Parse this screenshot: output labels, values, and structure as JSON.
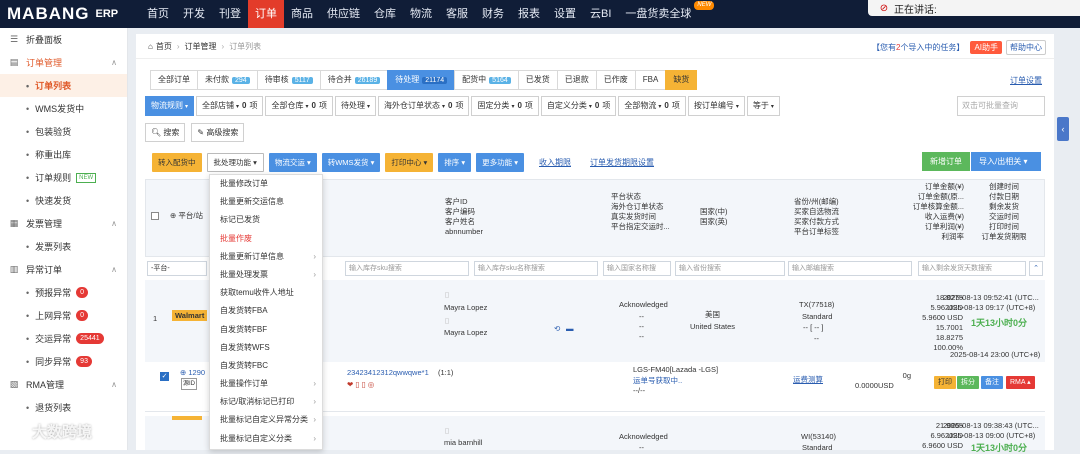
{
  "app": {
    "logo_text": "MABANG",
    "logo_o": "O",
    "logo_suffix": "ERP",
    "nav": [
      {
        "label": "首页"
      },
      {
        "label": "开发"
      },
      {
        "label": "刊登"
      },
      {
        "label": "订单",
        "active": true
      },
      {
        "label": "商品"
      },
      {
        "label": "供应链"
      },
      {
        "label": "仓库"
      },
      {
        "label": "物流"
      },
      {
        "label": "客服"
      },
      {
        "label": "财务"
      },
      {
        "label": "报表"
      },
      {
        "label": "设置"
      },
      {
        "label": "云BI"
      },
      {
        "label": "一盘货卖全球",
        "badge": "NEW"
      }
    ],
    "speaking": "正在讲话:"
  },
  "sidebar": {
    "collapse_label": "折叠面板",
    "groups": [
      {
        "label": "订单管理",
        "open": true,
        "items": [
          {
            "label": "订单列表",
            "selected": true
          },
          {
            "label": "WMS发货中"
          },
          {
            "label": "包装验货"
          },
          {
            "label": "称重出库"
          },
          {
            "label": "订单规则",
            "tag": "NEW"
          },
          {
            "label": "快速发货"
          }
        ]
      },
      {
        "label": "发票管理",
        "open": false,
        "items": [
          {
            "label": "发票列表"
          }
        ]
      },
      {
        "label": "异常订单",
        "open": false,
        "items": [
          {
            "label": "预报异常",
            "badge": "0"
          },
          {
            "label": "上网异常",
            "badge": "0"
          },
          {
            "label": "交运异常",
            "badge": "25441"
          },
          {
            "label": "同步异常",
            "badge": "93"
          }
        ]
      },
      {
        "label": "RMA管理",
        "open": false,
        "items": [
          {
            "label": "退货列表"
          }
        ]
      }
    ]
  },
  "breadcrumb": {
    "home": "首页",
    "level1": "订单管理",
    "current": "订单列表"
  },
  "tasks": {
    "prefix": "【您有",
    "count": "2",
    "suffix": "个导入中的任务】",
    "ai": "AI助手",
    "help": "帮助中心"
  },
  "tabs": [
    {
      "label": "全部订单"
    },
    {
      "label": "未付款",
      "count": "294"
    },
    {
      "label": "待审核",
      "count": "5117"
    },
    {
      "label": "待合并",
      "count": "26189"
    },
    {
      "label": "待处理",
      "count": "21174",
      "active": true
    },
    {
      "label": "配货中",
      "count": "5164"
    },
    {
      "label": "已发货"
    },
    {
      "label": "已退款"
    },
    {
      "label": "已作废"
    },
    {
      "label": "FBA"
    },
    {
      "label": "缺货",
      "orange": true
    }
  ],
  "order_settings": "订单设置",
  "filters_row1": [
    {
      "label": "物流规则",
      "style": "blue"
    },
    {
      "label": "全部店铺",
      "count": "0",
      "unit": "项"
    },
    {
      "label": "全部仓库",
      "count": "0",
      "unit": "项"
    },
    {
      "label": "待处理"
    },
    {
      "label": "海外仓订单状态",
      "count": "0",
      "unit": "项"
    },
    {
      "label": "固定分类",
      "count": "0",
      "unit": "项"
    },
    {
      "label": "自定义分类",
      "count": "0",
      "unit": "项"
    },
    {
      "label": "全部物流",
      "count": "0",
      "unit": "项"
    },
    {
      "label": "按订单编号"
    },
    {
      "label": "等于"
    }
  ],
  "search_placeholder": "双击可批量查询",
  "row2": {
    "search": "搜索",
    "advanced": "高级搜索"
  },
  "actions": {
    "to_allocation": "转入配货中",
    "batch": "批处理功能",
    "logistics": "物流交运",
    "to_wms": "转WMS发货",
    "print": "打印中心",
    "sort": "排序",
    "more": "更多功能",
    "deadline": "收入期限",
    "ship_deadline_settings": "订单发货期限设置",
    "new_order": "新增订单",
    "import_export": "导入/出相关"
  },
  "table_headers": {
    "platform": "平台/站",
    "customer": [
      "客户ID",
      "客户编码",
      "客户姓名",
      "abnnumber"
    ],
    "status": [
      "平台状态",
      "海外仓订单状态",
      "真实发货时间",
      "平台指定交运时..."
    ],
    "country": [
      "国家(中)",
      "国家(英)"
    ],
    "region": [
      "省份/州(邮编)",
      "买家自选物流",
      "买家付款方式",
      "平台订单标签"
    ],
    "amount": [
      "订单金额(¥)",
      "订单金额(原...",
      "订单核算金额...",
      "收入运费(¥)",
      "订单利润(¥)",
      "利润率"
    ],
    "time": [
      "创建时间",
      "付款日期",
      "剩余发货",
      "交运时间",
      "打印时间",
      "订单发货期限"
    ]
  },
  "filter_inputs": {
    "platform": "-平台-",
    "sku": "输入库存sku搜索",
    "sku_name": "输入库存sku名称搜索",
    "country": "输入国家名称搜",
    "province": "输入省份搜索",
    "zip": "输入邮编搜索",
    "remaining": "输入剩余发货天数搜索"
  },
  "dropdown": [
    {
      "label": "批量修改订单"
    },
    {
      "label": "批量更新交运信息"
    },
    {
      "label": "标记已发货"
    },
    {
      "label": "批量作废",
      "red": true
    },
    {
      "label": "批量更新订单信息",
      "sub": true
    },
    {
      "label": "批量处理发票",
      "sub": true
    },
    {
      "label": "获取temu收件人地址"
    },
    {
      "label": "自发货转FBA"
    },
    {
      "label": "自发货转FBF"
    },
    {
      "label": "自发货转WFS"
    },
    {
      "label": "自发货转FBC"
    },
    {
      "label": "批量操作订单",
      "sub": true
    },
    {
      "label": "标记/取消标记已打印",
      "sub": true
    },
    {
      "label": "批量标记自定义异常分类",
      "sub": true
    },
    {
      "label": "批量标记自定义分类",
      "sub": true
    }
  ],
  "order1": {
    "index": "1",
    "platform": "Walmart",
    "customer_name": "Mayra Lopez",
    "customer_name2": "Mayra Lopez",
    "status": "Acknowledged",
    "dash1": "--",
    "dash2": "--",
    "dash3": "--",
    "country_cn": "美国",
    "country_en": "United States",
    "region": "TX(77518)",
    "shipping": "Standard",
    "dash_region": "-- [ -- ]",
    "dash_region2": "--",
    "amounts": [
      "18.8275",
      "5.96 USD",
      "5.9600 USD",
      "15.7001",
      "18.8275",
      "100.00%"
    ],
    "times": [
      "2025-08-13 09:52:41 (UTC...",
      "2025-08-13 09:17 (UTC+8)",
      "1天13小时0分",
      "2025-08-14 23:00 (UTC+8)"
    ],
    "line_order_prefix": "1290",
    "line_sku": "23423412312qwwqwe*1",
    "line_qty": "(1:1)",
    "line_logistics": "LGS-FM40[Lazada -LGS]",
    "line_track": "运单号获取中..",
    "line_track2": "--/--",
    "line_estimate": "运费测算",
    "line_weight": "0g",
    "line_fee": "0.0000USD",
    "btn_print": "打印",
    "btn_split": "拆分",
    "btn_note": "备注",
    "btn_rma": "RMA"
  },
  "order2": {
    "customer_name": "mia barnhill",
    "status": "Acknowledged",
    "dash1": "--",
    "region": "WI(53140)",
    "shipping": "Standard",
    "amounts": [
      "21.9865",
      "6.96 USD",
      "6.9600 USD"
    ],
    "times": [
      "2025-08-13 09:38:43 (UTC...",
      "2025-08-13 09:00 (UTC+8)",
      "1天13小时0分"
    ]
  },
  "watermark": "大数跨境"
}
